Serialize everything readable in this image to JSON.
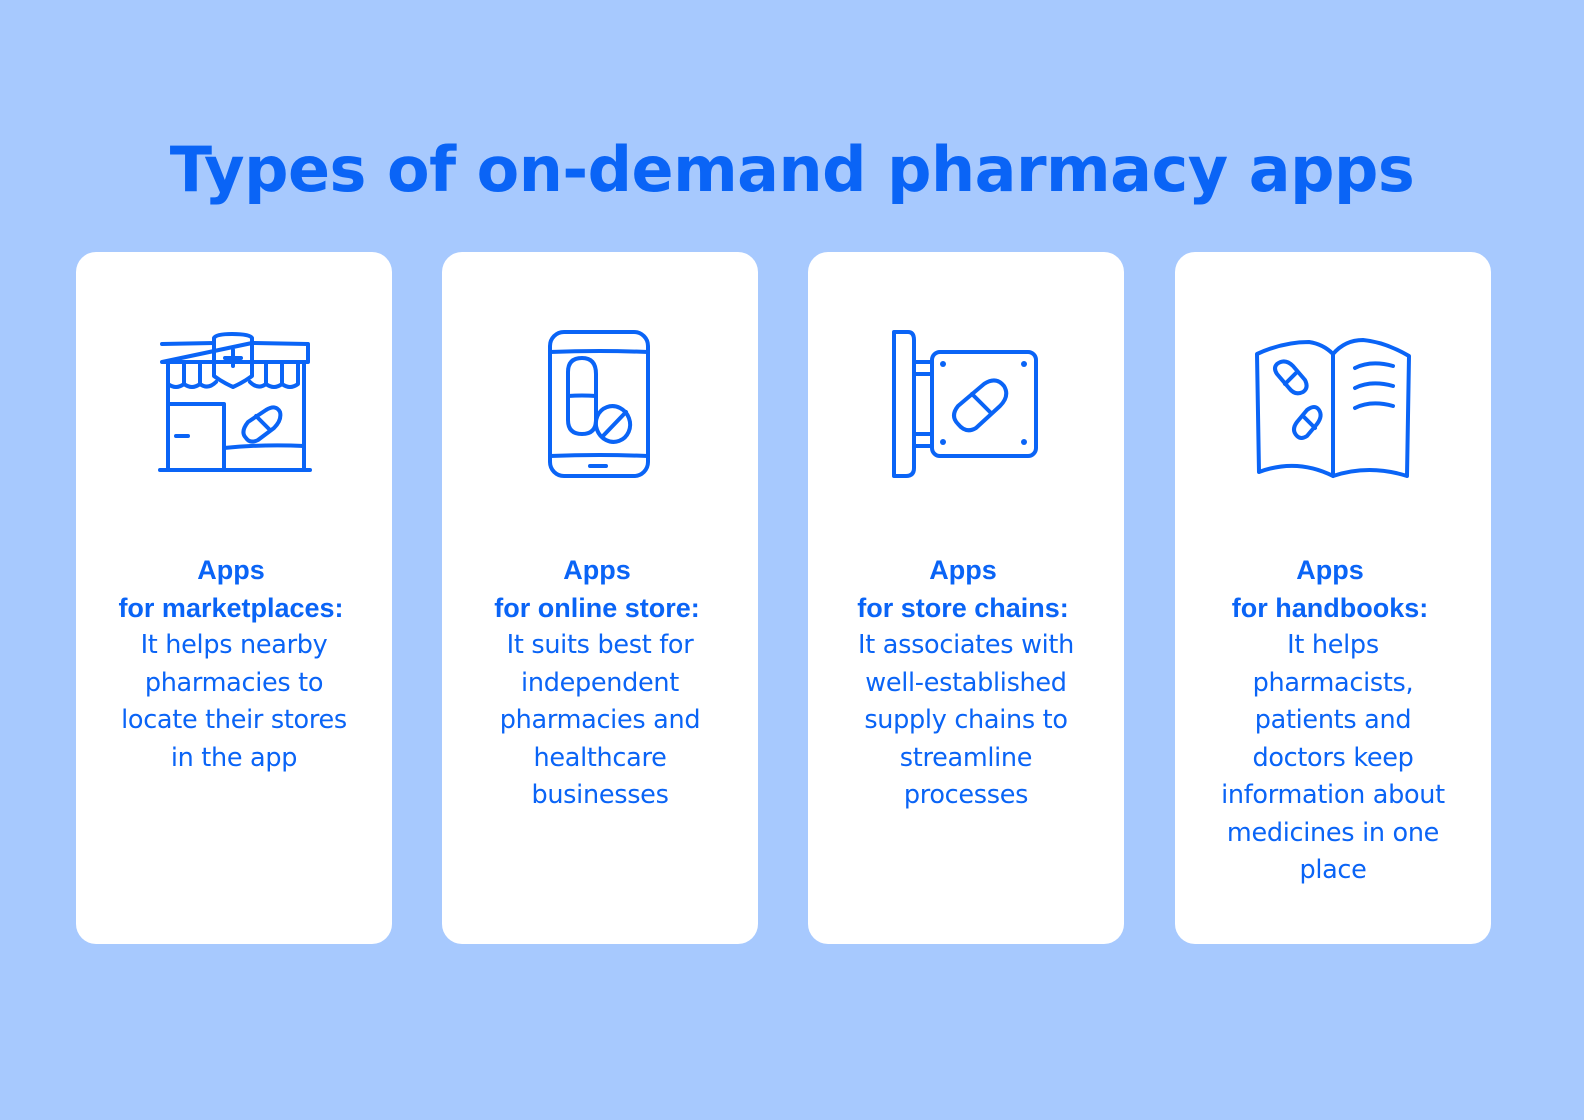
{
  "page": {
    "title": "Types of on-demand pharmacy apps",
    "background_color": "#a7c9fe",
    "accent_color": "#0a64f6",
    "card_color": "#ffffff"
  },
  "cards": [
    {
      "icon": "pharmacy-storefront-icon",
      "heading_line1": "Apps",
      "heading_line2": "for marketplaces:",
      "description": "It helps nearby pharmacies to locate their stores in the app",
      "description_lines": [
        "It helps nearby",
        "pharmacies to",
        "locate their stores",
        "in the app"
      ]
    },
    {
      "icon": "smartphone-pills-icon",
      "heading_line1": "Apps",
      "heading_line2": "for online store:",
      "description": "It suits best for independent pharmacies and healthcare businesses",
      "description_lines": [
        "It suits best for",
        "independent",
        "pharmacies and",
        "healthcare",
        "businesses"
      ]
    },
    {
      "icon": "hanging-sign-pill-icon",
      "heading_line1": "Apps",
      "heading_line2": "for store chains:",
      "description": "It associates with well-established supply chains to streamline processes",
      "description_lines": [
        "It associates with",
        "well-established",
        "supply chains to",
        "streamline",
        "processes"
      ]
    },
    {
      "icon": "open-book-pills-icon",
      "heading_line1": "Apps",
      "heading_line2": "for handbooks:",
      "description": "It helps pharmacists, patients and doctors keep information about medicines in one place",
      "description_lines": [
        "It helps",
        "pharmacists,",
        "patients and",
        "doctors keep",
        "information about",
        "medicines in one",
        "place"
      ]
    }
  ]
}
